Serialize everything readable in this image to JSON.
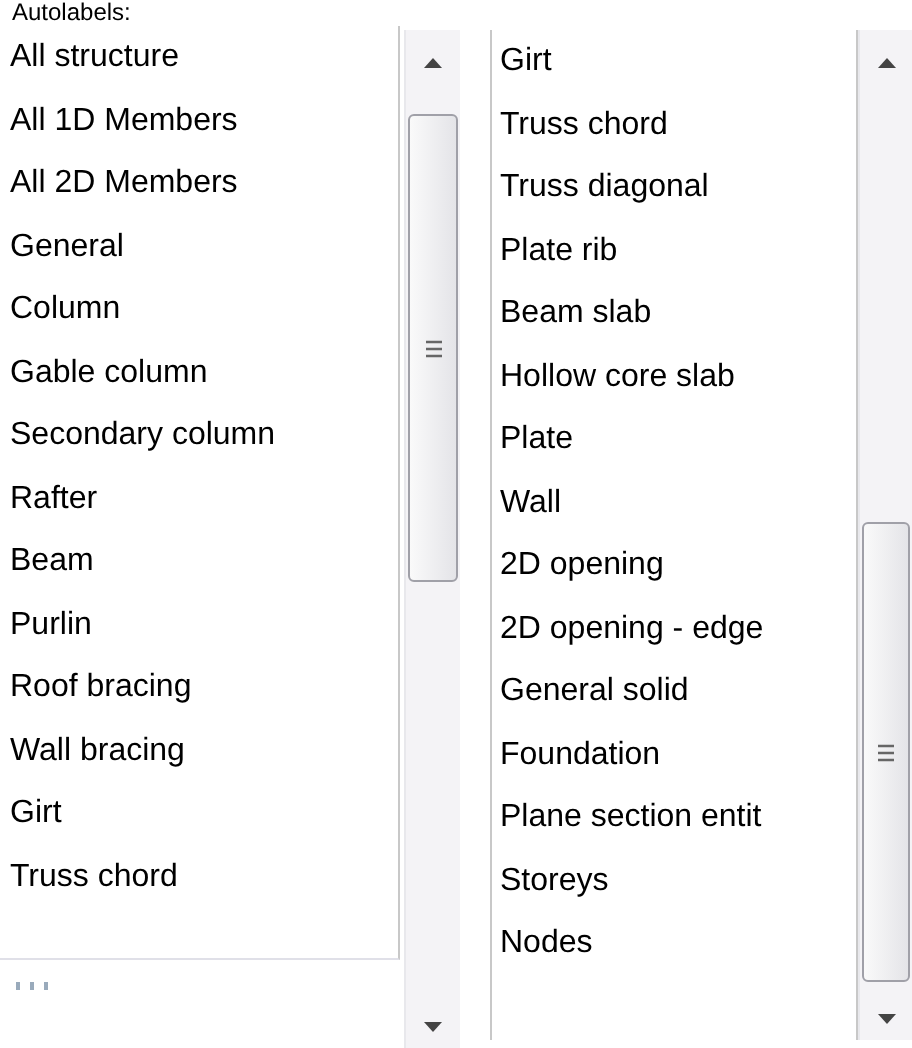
{
  "header": "Autolabels:",
  "lists": [
    {
      "items": [
        "All structure",
        "All 1D Members",
        "All 2D Members",
        "General",
        "Column",
        "Gable column",
        "Secondary column",
        "Rafter",
        "Beam",
        "Purlin",
        "Roof bracing",
        "Wall bracing",
        "Girt",
        "Truss chord"
      ]
    },
    {
      "items": [
        "Girt",
        "Truss chord",
        "Truss diagonal",
        "Plate rib",
        "Beam slab",
        "Hollow core slab",
        "Plate",
        "Wall",
        "2D opening",
        "2D opening - edge",
        "General solid",
        "Foundation",
        "Plane section entit",
        "Storeys",
        "Nodes"
      ]
    }
  ]
}
